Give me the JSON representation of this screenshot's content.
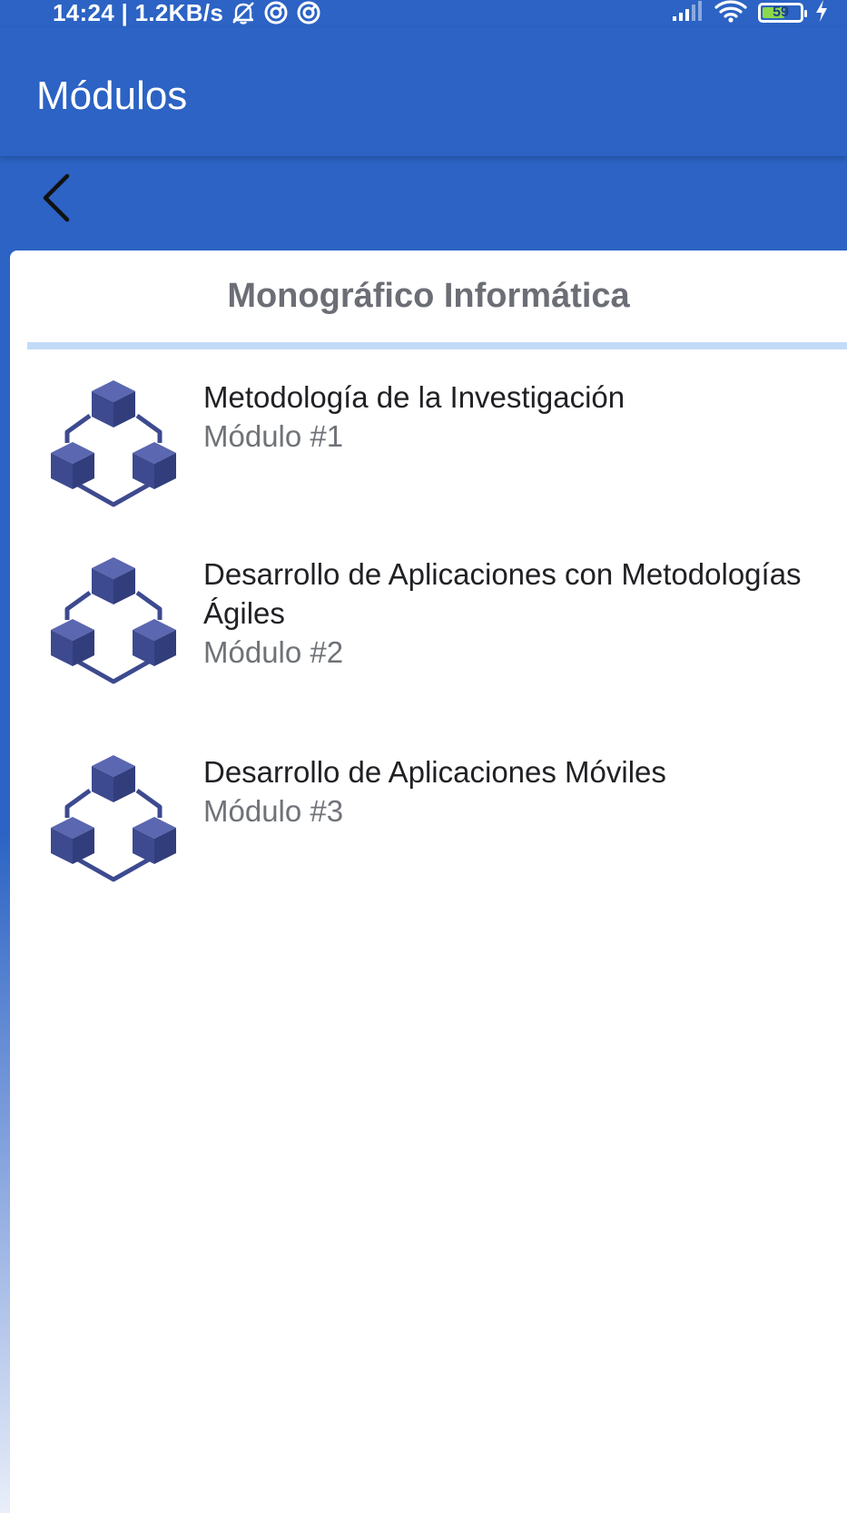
{
  "status_bar": {
    "time_speed": "14:24 | 1.2KB/s",
    "battery": "59",
    "battery_fraction": 0.59,
    "icons": [
      "notifications-off-icon",
      "sync-icon",
      "sync-icon",
      "signal-icon",
      "wifi-icon",
      "battery-icon",
      "charging-bolt-icon"
    ]
  },
  "app_bar": {
    "title": "Módulos"
  },
  "nav": {
    "back_icon": "chevron-left-icon"
  },
  "card": {
    "title": "Monográfico Informática"
  },
  "modules": [
    {
      "name": "Metodología de la Investigación",
      "subtitle": "Módulo #1",
      "icon": "cubes-network-icon"
    },
    {
      "name": "Desarrollo de Aplicaciones con Metodologías Ágiles",
      "subtitle": "Módulo #2",
      "icon": "cubes-network-icon"
    },
    {
      "name": "Desarrollo de Aplicaciones Móviles",
      "subtitle": "Módulo #3",
      "icon": "cubes-network-icon"
    }
  ],
  "colors": {
    "primary": "#2c63c4",
    "divider": "#c3dbf8",
    "icon": "#3d4a8f",
    "battery_fill": "#8bd94a"
  }
}
